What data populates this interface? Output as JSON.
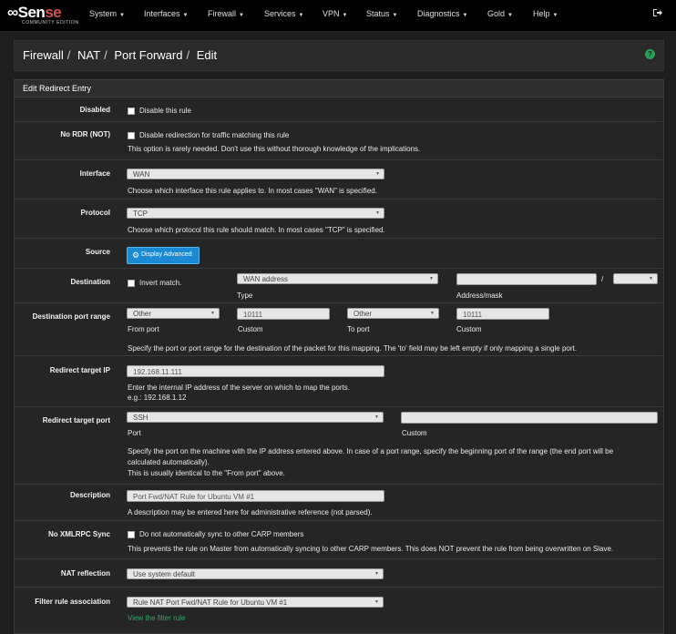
{
  "nav": {
    "brand_part1": "Sen",
    "brand_part2": "se",
    "brand_sub": "COMMUNITY EDITION",
    "items": [
      {
        "label": "System"
      },
      {
        "label": "Interfaces"
      },
      {
        "label": "Firewall"
      },
      {
        "label": "Services"
      },
      {
        "label": "VPN"
      },
      {
        "label": "Status"
      },
      {
        "label": "Diagnostics"
      },
      {
        "label": "Gold"
      },
      {
        "label": "Help"
      }
    ],
    "logout_icon": "sign-out-icon"
  },
  "breadcrumb": {
    "items": [
      "Firewall",
      "NAT",
      "Port Forward",
      "Edit"
    ],
    "separator": "/",
    "help_label": "?"
  },
  "panel": {
    "heading": "Edit Redirect Entry",
    "disabled": {
      "label": "Disabled",
      "option": "Disable this rule",
      "checked": false
    },
    "nordr": {
      "label": "No RDR (NOT)",
      "option": "Disable redirection for traffic matching this rule",
      "help": "This option is rarely needed. Don't use this without thorough knowledge of the implications.",
      "checked": false
    },
    "interface": {
      "label": "Interface",
      "value": "WAN",
      "help": "Choose which interface this rule applies to. In most cases \"WAN\" is specified."
    },
    "protocol": {
      "label": "Protocol",
      "value": "TCP",
      "help": "Choose which protocol this rule should match. In most cases \"TCP\" is specified."
    },
    "source": {
      "label": "Source",
      "button": "Display Advanced"
    },
    "destination": {
      "label": "Destination",
      "invert": "Invert match.",
      "type_value": "WAN address",
      "type_caption": "Type",
      "address_value": "",
      "mask_sep": "/",
      "address_caption": "Address/mask"
    },
    "dest_port_range": {
      "label": "Destination port range",
      "from_value": "Other",
      "from_caption": "From port",
      "from_custom": "10111",
      "from_custom_caption": "Custom",
      "to_value": "Other",
      "to_caption": "To port",
      "to_custom": "10111",
      "to_custom_caption": "Custom",
      "help": "Specify the port or port range for the destination of the packet for this mapping. The 'to' field may be left empty if only mapping a single port."
    },
    "redirect_ip": {
      "label": "Redirect target IP",
      "value": "192.168.11.111",
      "help1": "Enter the internal IP address of the server on which to map the ports.",
      "help2": "e.g.: 192.168.1.12"
    },
    "redirect_port": {
      "label": "Redirect target port",
      "value": "SSH",
      "port_caption": "Port",
      "custom_value": "",
      "custom_caption": "Custom",
      "help1": "Specify the port on the machine with the IP address entered above. In case of a port range, specify the beginning port of the range (the end port will be",
      "help2": "calculated automatically).",
      "help3": "This is usually identical to the \"From port\" above."
    },
    "description": {
      "label": "Description",
      "value": "Port Fwd/NAT Rule for Ubuntu VM #1",
      "help": "A description may be entered here for administrative reference (not parsed)."
    },
    "xmlrpc": {
      "label": "No XMLRPC Sync",
      "option": "Do not automatically sync to other CARP members",
      "help": "This prevents the rule on Master from automatically syncing to other CARP members. This does NOT prevent the rule from being overwritten on Slave.",
      "checked": false
    },
    "nat_reflection": {
      "label": "NAT reflection",
      "value": "Use system default"
    },
    "filter_assoc": {
      "label": "Filter rule association",
      "value": "Rule NAT Port Fwd/NAT Rule for Ubuntu VM #1",
      "link": "View the filter rule"
    }
  },
  "colors": {
    "background": "#1e1e1e",
    "navbar": "#000000",
    "accent_blue": "#1a8ad4",
    "link_green": "#35a56b",
    "brand_red": "#d9534f"
  }
}
